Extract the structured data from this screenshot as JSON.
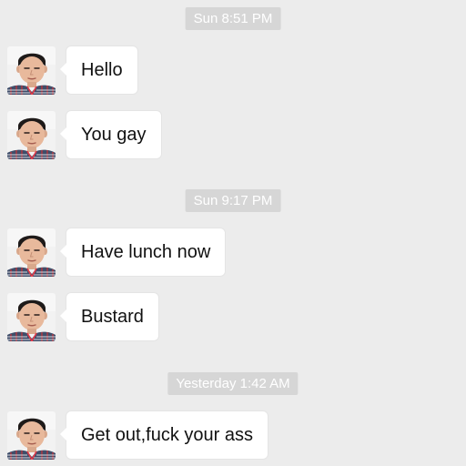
{
  "timestamps": [
    "Sun 8:51 PM",
    "Sun 9:17 PM",
    "Yesterday 1:42 AM"
  ],
  "messages": [
    {
      "text": "Hello",
      "avatar": "avatar-icon"
    },
    {
      "text": "You gay",
      "avatar": "avatar-icon"
    },
    {
      "text": "Have lunch now",
      "avatar": "avatar-icon"
    },
    {
      "text": "Bustard",
      "avatar": "avatar-icon"
    },
    {
      "text": "Get out,fuck your ass",
      "avatar": "avatar-icon"
    }
  ],
  "colors": {
    "background": "#ececec",
    "timestamp_bg": "#d6d6d6",
    "bubble": "#ffffff"
  }
}
